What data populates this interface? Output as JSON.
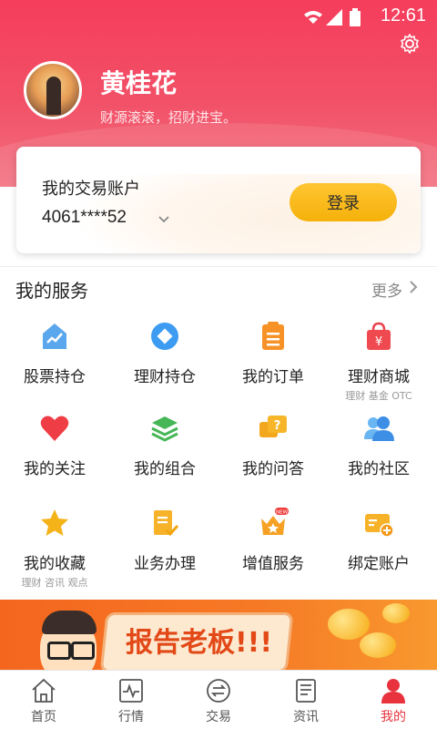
{
  "status_bar": {
    "time": "12:61"
  },
  "profile": {
    "name": "黄桂花",
    "slogan": "财源滚滚，招财进宝。"
  },
  "account": {
    "label": "我的交易账户",
    "number": "4061****52",
    "login_label": "登录"
  },
  "services": {
    "title": "我的服务",
    "more_label": "更多",
    "items": [
      {
        "label": "股票持仓",
        "icon": "stock-holdings-icon"
      },
      {
        "label": "理财持仓",
        "icon": "wealth-holdings-icon"
      },
      {
        "label": "我的订单",
        "icon": "orders-icon"
      },
      {
        "label": "理财商城",
        "sub": "理财 基金 OTC",
        "icon": "wealth-mall-icon"
      },
      {
        "label": "我的关注",
        "icon": "heart-icon"
      },
      {
        "label": "我的组合",
        "icon": "portfolio-icon"
      },
      {
        "label": "我的问答",
        "icon": "qa-icon"
      },
      {
        "label": "我的社区",
        "icon": "community-icon"
      },
      {
        "label": "我的收藏",
        "sub": "理财 咨讯 观点",
        "icon": "star-icon"
      },
      {
        "label": "业务办理",
        "icon": "business-icon"
      },
      {
        "label": "增值服务",
        "badge": "NEW",
        "icon": "vip-service-icon"
      },
      {
        "label": "绑定账户",
        "icon": "bind-account-icon"
      }
    ]
  },
  "banner": {
    "text": "报告老板!!!"
  },
  "tabbar": {
    "tabs": [
      {
        "label": "首页",
        "icon": "home-icon"
      },
      {
        "label": "行情",
        "icon": "market-icon"
      },
      {
        "label": "交易",
        "icon": "trade-icon"
      },
      {
        "label": "资讯",
        "icon": "news-icon"
      },
      {
        "label": "我的",
        "icon": "profile-icon",
        "active": true
      }
    ]
  },
  "colors": {
    "header_red": "#f53d5c",
    "accent_yellow": "#f5b10a",
    "active_tab": "#e8323e"
  }
}
